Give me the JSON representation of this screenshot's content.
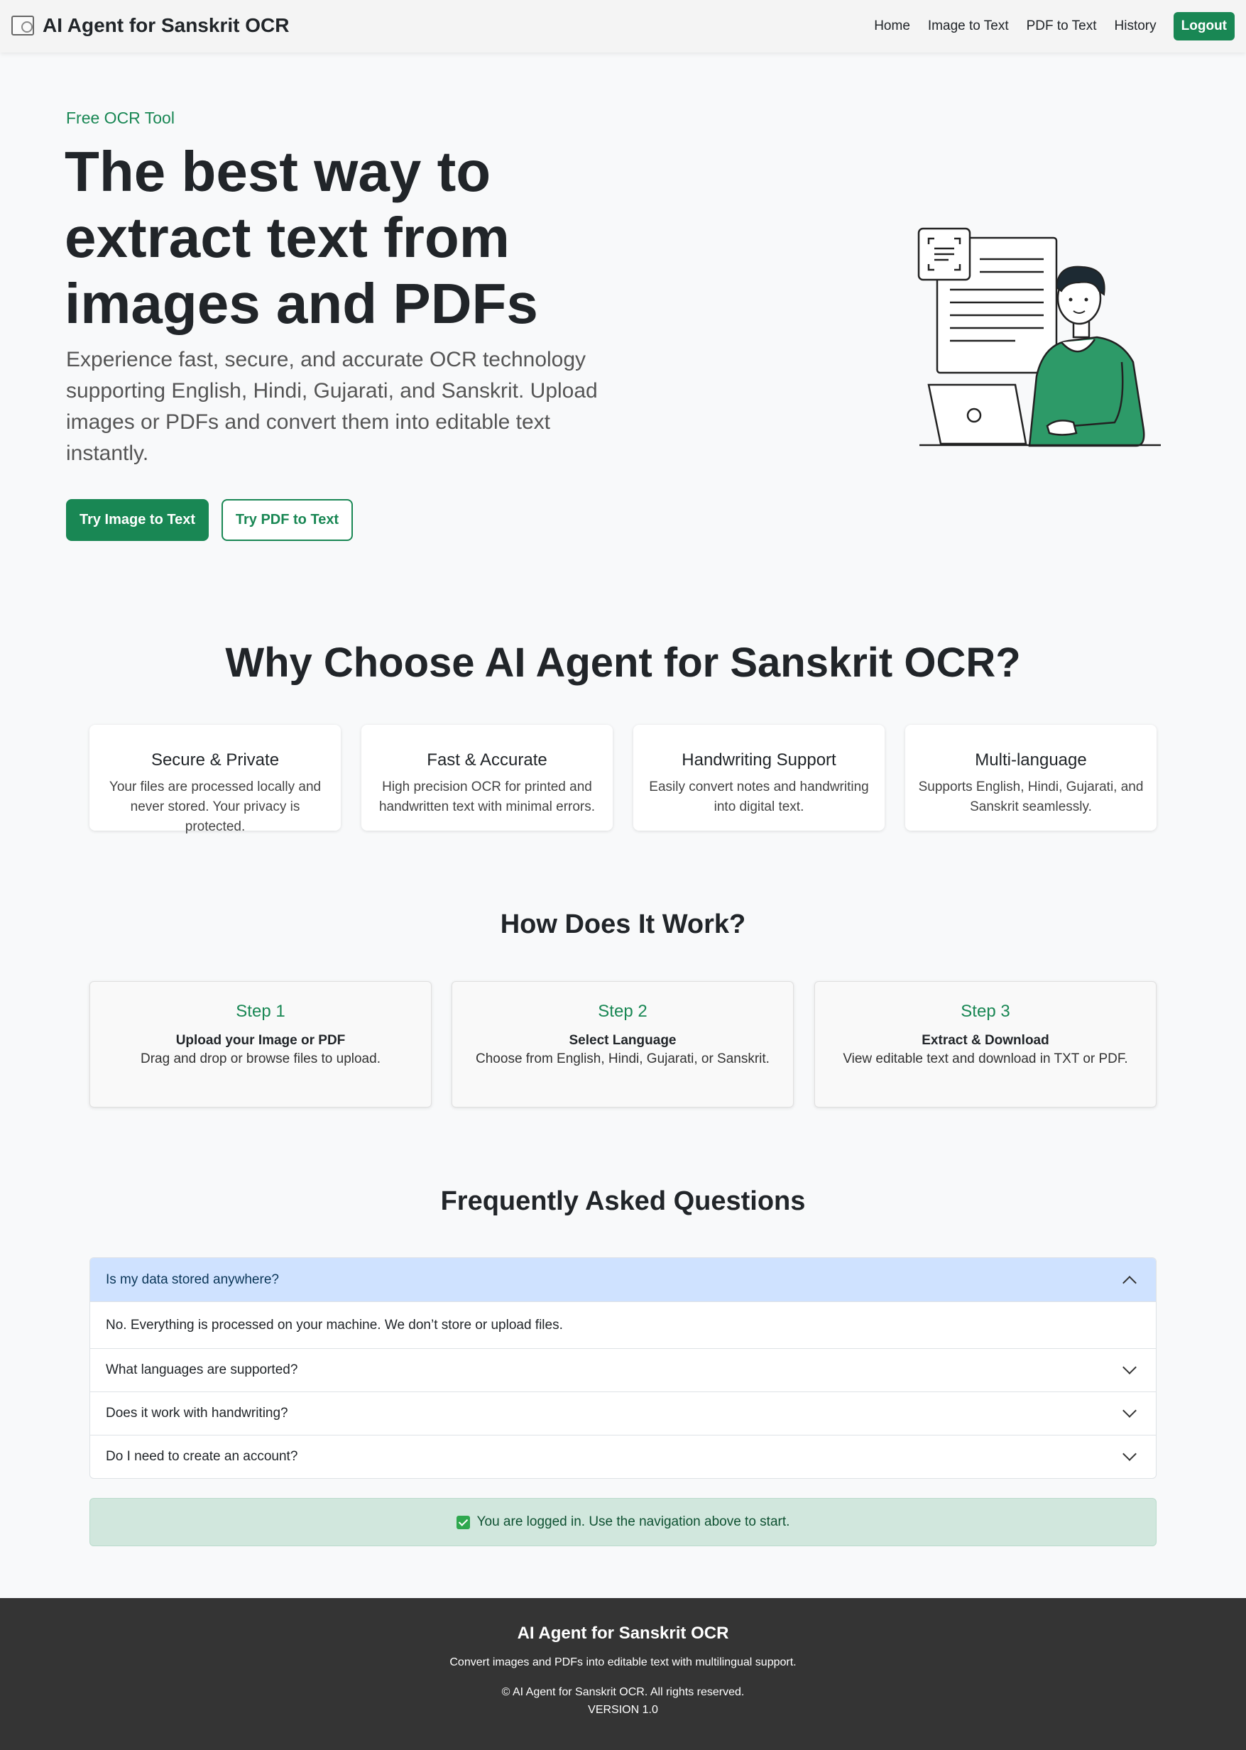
{
  "navbar": {
    "brand": "AI Agent for Sanskrit OCR",
    "links": [
      "Home",
      "Image to Text",
      "PDF to Text",
      "History"
    ],
    "logout": "Logout"
  },
  "hero": {
    "eyebrow": "Free OCR Tool",
    "title": "The best way to extract text from images and PDFs",
    "description": "Experience fast, secure, and accurate OCR technology supporting English, Hindi, Gujarati, and Sanskrit. Upload images or PDFs and convert them into editable text instantly.",
    "primary_button": "Try Image to Text",
    "secondary_button": "Try PDF to Text"
  },
  "why": {
    "title": "Why Choose AI Agent for Sanskrit OCR?",
    "cards": [
      {
        "title": "Secure & Private",
        "desc": "Your files are processed locally and never stored. Your privacy is protected."
      },
      {
        "title": "Fast & Accurate",
        "desc": "High precision OCR for printed and handwritten text with minimal errors."
      },
      {
        "title": "Handwriting Support",
        "desc": "Easily convert notes and handwriting into digital text."
      },
      {
        "title": "Multi-language",
        "desc": "Supports English, Hindi, Gujarati, and Sanskrit seamlessly."
      }
    ]
  },
  "how": {
    "title": "How Does It Work?",
    "steps": [
      {
        "step": "Step 1",
        "heading": "Upload your Image or PDF",
        "desc": "Drag and drop or browse files to upload."
      },
      {
        "step": "Step 2",
        "heading": "Select Language",
        "desc": "Choose from English, Hindi, Gujarati, or Sanskrit."
      },
      {
        "step": "Step 3",
        "heading": "Extract & Download",
        "desc": "View editable text and download in TXT or PDF."
      }
    ]
  },
  "faq": {
    "title": "Frequently Asked Questions",
    "items": [
      {
        "q": "Is my data stored anywhere?",
        "a": "No. Everything is processed on your machine. We don’t store or upload files."
      },
      {
        "q": "What languages are supported?"
      },
      {
        "q": "Does it work with handwriting?"
      },
      {
        "q": "Do I need to create an account?"
      }
    ]
  },
  "alert": "You are logged in. Use the navigation above to start.",
  "footer": {
    "title": "AI Agent for Sanskrit OCR",
    "tagline": "Convert images and PDFs into editable text with multilingual support.",
    "copyright": "© AI Agent for Sanskrit OCR. All rights reserved.",
    "version": "VERSION 1.0"
  },
  "colors": {
    "accent": "#198754",
    "faq_open": "#cfe2ff",
    "alert_bg": "#d1e7dd",
    "footer_bg": "#343434"
  }
}
